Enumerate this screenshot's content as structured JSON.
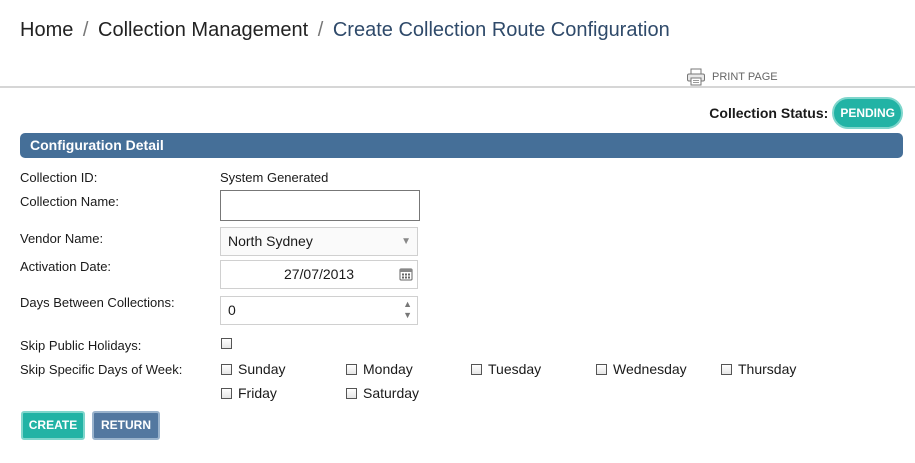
{
  "breadcrumb": {
    "items": [
      "Home",
      "Collection Management",
      "Create Collection Route Configuration"
    ],
    "separator": "/"
  },
  "print": {
    "label": "PRINT PAGE",
    "icon": "printer-icon"
  },
  "status": {
    "label": "Collection Status:",
    "value": "PENDING",
    "color": "#22b3a5"
  },
  "section": {
    "title": "Configuration Detail",
    "color": "#456f98"
  },
  "form": {
    "collection_id": {
      "label": "Collection ID:",
      "value": "System Generated"
    },
    "collection_name": {
      "label": "Collection Name:",
      "value": ""
    },
    "vendor_name": {
      "label": "Vendor Name:",
      "value": "North Sydney"
    },
    "activation_date": {
      "label": "Activation Date:",
      "value": "27/07/2013",
      "icon": "calendar-icon"
    },
    "days_between": {
      "label": "Days Between Collections:",
      "value": "0"
    },
    "skip_holidays": {
      "label": "Skip Public Holidays:",
      "checked": false
    },
    "skip_days": {
      "label": "Skip Specific Days of Week:",
      "days": [
        {
          "label": "Sunday",
          "checked": false
        },
        {
          "label": "Monday",
          "checked": false
        },
        {
          "label": "Tuesday",
          "checked": false
        },
        {
          "label": "Wednesday",
          "checked": false
        },
        {
          "label": "Thursday",
          "checked": false
        },
        {
          "label": "Friday",
          "checked": false
        },
        {
          "label": "Saturday",
          "checked": false
        }
      ]
    }
  },
  "actions": {
    "create": "CREATE",
    "return": "RETURN"
  }
}
